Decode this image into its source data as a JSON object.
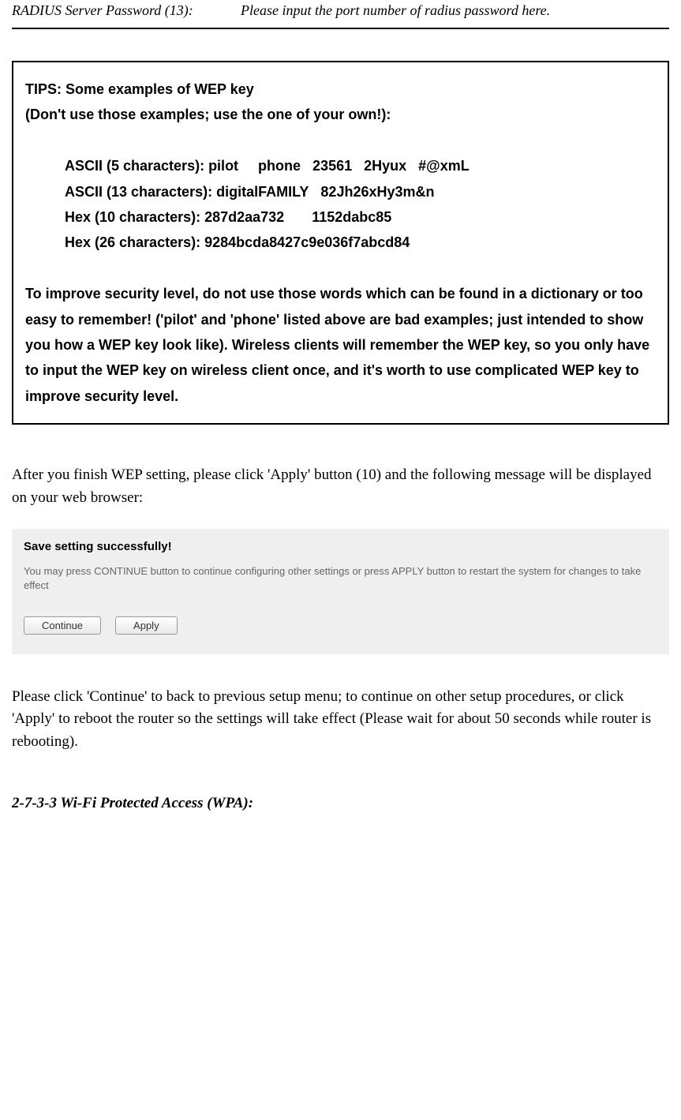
{
  "tableRow": {
    "left": "RADIUS Server Password (13):",
    "right": "Please input the port number of radius password here."
  },
  "tipsBox": {
    "title": "TIPS: Some examples of WEP key",
    "subtitle": "(Don't use those examples; use the one of your own!):",
    "examples": {
      "line1": "ASCII (5 characters): pilot     phone   23561   2Hyux   #@xmL",
      "line2": "ASCII (13 characters): digitalFAMILY   82Jh26xHy3m&n",
      "line3": "Hex (10 characters): 287d2aa732       1152dabc85",
      "line4": "Hex (26 characters): 9284bcda8427c9e036f7abcd84"
    },
    "footer": "To improve security level, do not use those words which can be found in a dictionary or too easy to remember! ('pilot' and 'phone' listed above are bad examples; just intended to show you how a WEP key look like). Wireless clients will remember the WEP key, so you only have to input the WEP key on wireless client once, and it's worth to use complicated WEP key to improve security level."
  },
  "paragraph1": "After you finish WEP setting, please click 'Apply' button (10) and the following message will be displayed on your web browser:",
  "screenshot": {
    "title": "Save setting successfully!",
    "description": "You may press CONTINUE button to continue configuring other settings or press APPLY button to restart the system for changes to take effect",
    "continueLabel": "Continue",
    "applyLabel": "Apply"
  },
  "paragraph2": "Please click 'Continue' to back to previous setup menu; to continue on other setup procedures, or click 'Apply' to reboot the router so the settings will take effect (Please wait for about 50 seconds while router is rebooting).",
  "sectionHeading": "2-7-3-3 Wi-Fi Protected Access (WPA):"
}
